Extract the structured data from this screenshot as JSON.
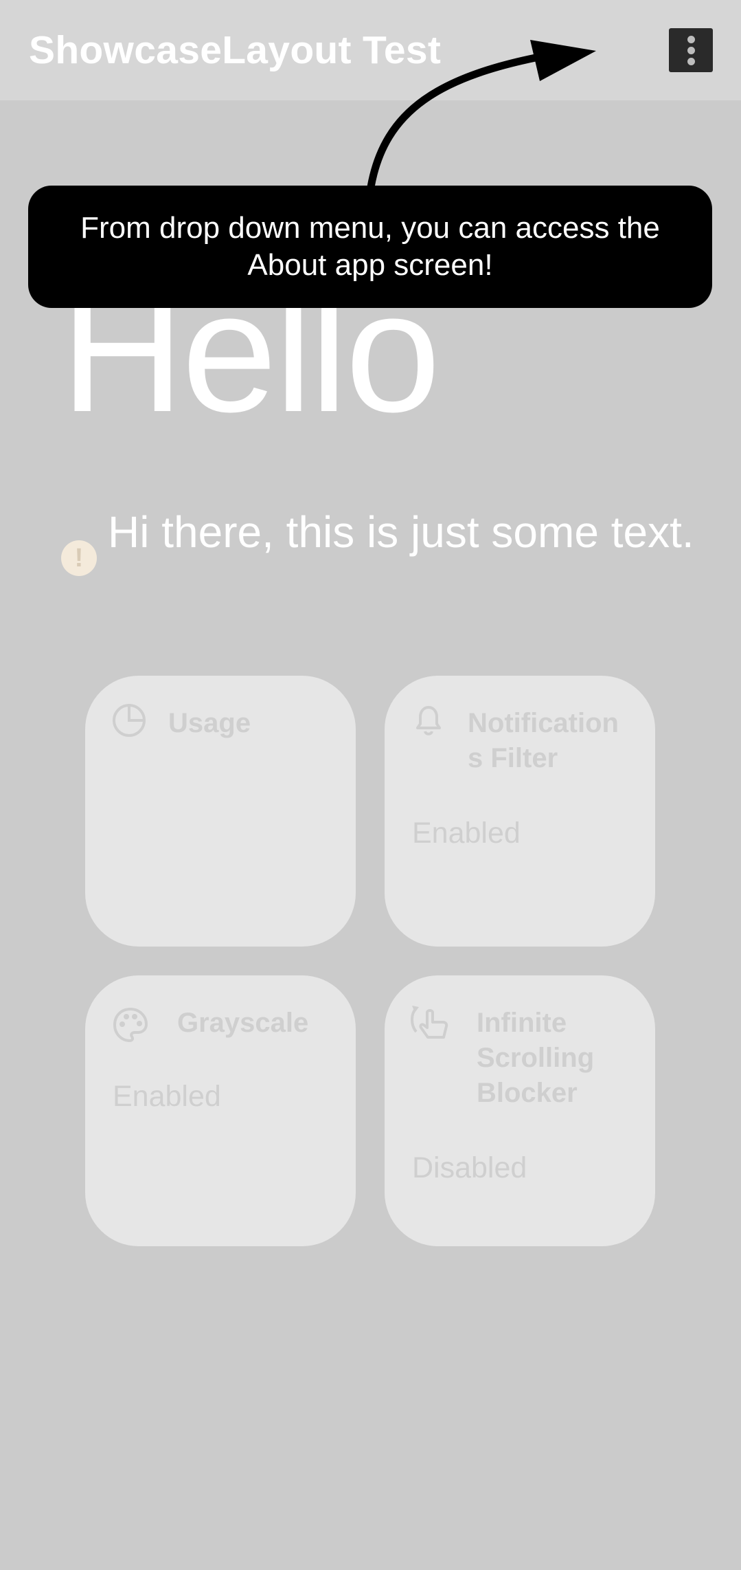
{
  "app_bar": {
    "title": "ShowcaseLayout Test",
    "menu_icon": "more-vert-icon"
  },
  "tooltip": {
    "text": "From drop down menu, you can access the About app screen!"
  },
  "hero": {
    "greeting": "Hello"
  },
  "info": {
    "icon": "exclamation-icon",
    "text": "Hi there, this is just some text."
  },
  "cards": [
    {
      "title": "Usage",
      "status": "",
      "icon": "pie-chart-icon"
    },
    {
      "title": "Notifications Filter",
      "title_line1": "Notification",
      "title_line2": "s Filter",
      "status": "Enabled",
      "icon": "bell-icon"
    },
    {
      "title": "Grayscale",
      "status": "Enabled",
      "icon": "palette-icon"
    },
    {
      "title": "Infinite Scrolling Blocker",
      "title_line1": "Infinite",
      "title_line2": "Scrolling",
      "title_line3": "Blocker",
      "status": "Disabled",
      "icon": "swipe-icon"
    }
  ],
  "colors": {
    "scrim": "#cbcbcb",
    "tooltip_bg": "#000000",
    "card_bg": "#e6e6e6",
    "card_text": "#cfcfcf"
  }
}
